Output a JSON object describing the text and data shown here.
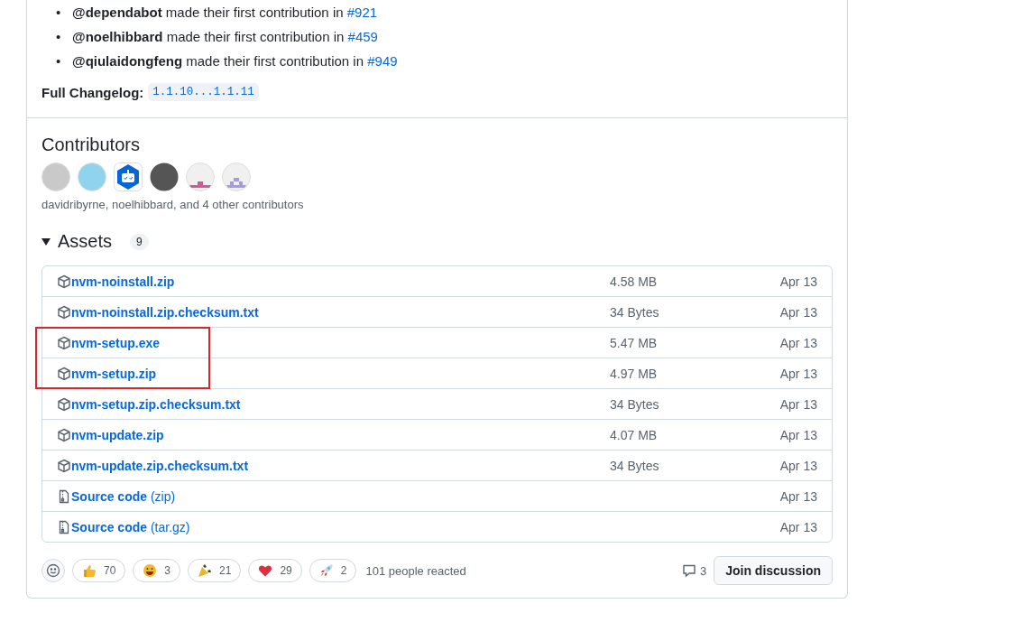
{
  "new_contributors": [
    {
      "marker": "•",
      "user": "@dependabot",
      "text": "made their first contribution in",
      "link": "#921"
    },
    {
      "marker": "•",
      "user": "@noelhibbard",
      "text": "made their first contribution in",
      "link": "#459"
    },
    {
      "marker": "•",
      "user": "@qiulaidongfeng",
      "text": "made their first contribution in",
      "link": "#949"
    }
  ],
  "changelog": {
    "label": "Full Changelog:",
    "range": "1.1.10...1.1.11"
  },
  "contributors": {
    "title": "Contributors",
    "summary": "davidribyrne, noelhibbard, and 4 other contributors"
  },
  "assets": {
    "title": "Assets",
    "count": "9",
    "expanded": true,
    "rows": [
      {
        "kind": "package",
        "name": "nvm-noinstall.zip",
        "size": "4.58 MB",
        "date": "Apr 13",
        "highlighted": false
      },
      {
        "kind": "package",
        "name": "nvm-noinstall.zip.checksum.txt",
        "size": "34 Bytes",
        "date": "Apr 13",
        "highlighted": false
      },
      {
        "kind": "package",
        "name": "nvm-setup.exe",
        "size": "5.47 MB",
        "date": "Apr 13",
        "highlighted": true
      },
      {
        "kind": "package",
        "name": "nvm-setup.zip",
        "size": "4.97 MB",
        "date": "Apr 13",
        "highlighted": true
      },
      {
        "kind": "package",
        "name": "nvm-setup.zip.checksum.txt",
        "size": "34 Bytes",
        "date": "Apr 13",
        "highlighted": false
      },
      {
        "kind": "package",
        "name": "nvm-update.zip",
        "size": "4.07 MB",
        "date": "Apr 13",
        "highlighted": false
      },
      {
        "kind": "package",
        "name": "nvm-update.zip.checksum.txt",
        "size": "34 Bytes",
        "date": "Apr 13",
        "highlighted": false
      },
      {
        "kind": "source",
        "name": "Source code",
        "suffix": "(zip)",
        "date": "Apr 13",
        "highlighted": false
      },
      {
        "kind": "source",
        "name": "Source code",
        "suffix": "(tar.gz)",
        "date": "Apr 13",
        "highlighted": false
      }
    ]
  },
  "reactions": {
    "items": [
      {
        "kind": "thumbs_up",
        "count": "70"
      },
      {
        "kind": "laugh",
        "count": "3"
      },
      {
        "kind": "hooray",
        "count": "21"
      },
      {
        "kind": "heart",
        "count": "29"
      },
      {
        "kind": "rocket",
        "count": "2"
      }
    ],
    "summary": "101 people reacted"
  },
  "comments": {
    "count": "3"
  },
  "join_button": "Join discussion"
}
